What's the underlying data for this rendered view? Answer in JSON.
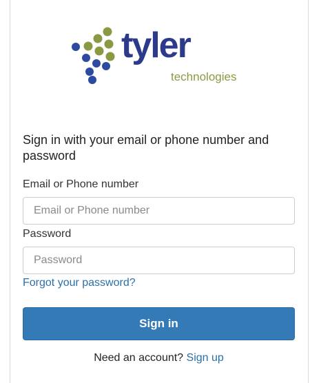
{
  "brand": {
    "wordmark": "tyler",
    "subline": "technologies",
    "colors": {
      "navy": "#2d3a8c",
      "olive": "#8a9a44",
      "blue_dot": "#2d4aa0"
    }
  },
  "form": {
    "heading": "Sign in with your email or phone number and password",
    "email_label": "Email or Phone number",
    "email_placeholder": "Email or Phone number",
    "email_value": "",
    "password_label": "Password",
    "password_placeholder": "Password",
    "password_value": "",
    "forgot_link": "Forgot your password?",
    "submit_label": "Sign in",
    "submit_color": "#337ab7",
    "signup_prompt": "Need an account?",
    "signup_link": "Sign up"
  }
}
